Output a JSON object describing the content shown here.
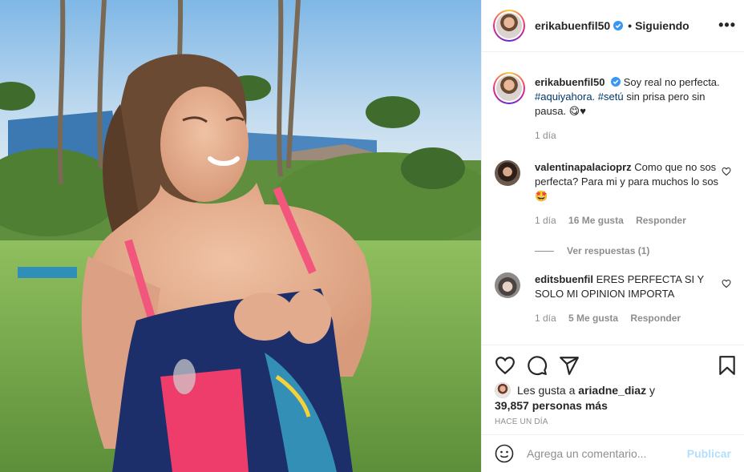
{
  "post": {
    "username": "erikabuenfil50",
    "follow_status": "Siguiendo",
    "separator": "•"
  },
  "caption": {
    "username": "erikabuenfil50",
    "text": "Soy real no perfecta.",
    "hashtag1": "#aquiyahora.",
    "hashtag2": "#setú",
    "text2": "sin prisa pero sin pausa.",
    "emoji": "😋♥",
    "time": "1 día"
  },
  "comments": [
    {
      "username": "valentinapalacioprz",
      "text": "Como que no sos perfecta? Para mi y para muchos lo sos🤩",
      "time": "1 día",
      "likes": "16 Me gusta",
      "reply": "Responder",
      "view_replies": "Ver respuestas (1)"
    },
    {
      "username": "editsbuenfil",
      "text": "ERES PERFECTA SI Y SOLO MI OPINION IMPORTA",
      "time": "1 día",
      "likes": "5 Me gusta",
      "reply": "Responder"
    }
  ],
  "likes": {
    "prefix": "Les gusta a",
    "user": "ariadne_diaz",
    "conj": "y",
    "others": "39,857 personas más"
  },
  "timestamp": "Hace un día",
  "comment_box": {
    "placeholder": "Agrega un comentario...",
    "submit": "Publicar"
  },
  "colors": {
    "verified": "#3897f0",
    "link": "#00376b",
    "muted": "#8e8e8e",
    "publish_disabled": "#b2dffc"
  },
  "icons": [
    "more-options-icon",
    "verified-badge-icon",
    "heart-icon",
    "comment-icon",
    "share-icon",
    "bookmark-icon",
    "smiley-icon"
  ]
}
